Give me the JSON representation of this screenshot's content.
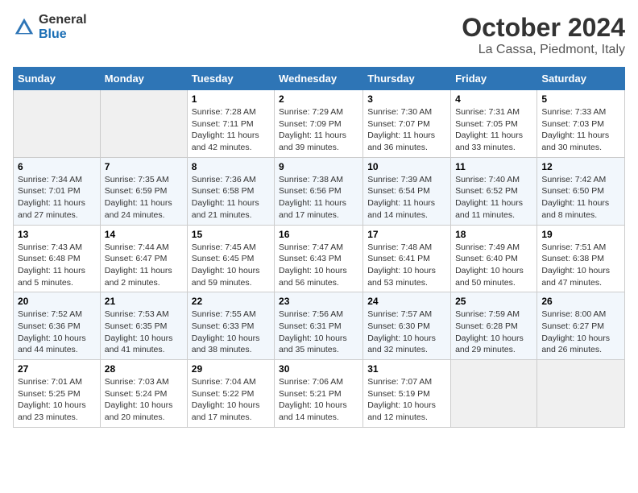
{
  "logo": {
    "general": "General",
    "blue": "Blue"
  },
  "title": "October 2024",
  "location": "La Cassa, Piedmont, Italy",
  "days_header": [
    "Sunday",
    "Monday",
    "Tuesday",
    "Wednesday",
    "Thursday",
    "Friday",
    "Saturday"
  ],
  "weeks": [
    [
      {
        "num": "",
        "info": ""
      },
      {
        "num": "",
        "info": ""
      },
      {
        "num": "1",
        "info": "Sunrise: 7:28 AM\nSunset: 7:11 PM\nDaylight: 11 hours and 42 minutes."
      },
      {
        "num": "2",
        "info": "Sunrise: 7:29 AM\nSunset: 7:09 PM\nDaylight: 11 hours and 39 minutes."
      },
      {
        "num": "3",
        "info": "Sunrise: 7:30 AM\nSunset: 7:07 PM\nDaylight: 11 hours and 36 minutes."
      },
      {
        "num": "4",
        "info": "Sunrise: 7:31 AM\nSunset: 7:05 PM\nDaylight: 11 hours and 33 minutes."
      },
      {
        "num": "5",
        "info": "Sunrise: 7:33 AM\nSunset: 7:03 PM\nDaylight: 11 hours and 30 minutes."
      }
    ],
    [
      {
        "num": "6",
        "info": "Sunrise: 7:34 AM\nSunset: 7:01 PM\nDaylight: 11 hours and 27 minutes."
      },
      {
        "num": "7",
        "info": "Sunrise: 7:35 AM\nSunset: 6:59 PM\nDaylight: 11 hours and 24 minutes."
      },
      {
        "num": "8",
        "info": "Sunrise: 7:36 AM\nSunset: 6:58 PM\nDaylight: 11 hours and 21 minutes."
      },
      {
        "num": "9",
        "info": "Sunrise: 7:38 AM\nSunset: 6:56 PM\nDaylight: 11 hours and 17 minutes."
      },
      {
        "num": "10",
        "info": "Sunrise: 7:39 AM\nSunset: 6:54 PM\nDaylight: 11 hours and 14 minutes."
      },
      {
        "num": "11",
        "info": "Sunrise: 7:40 AM\nSunset: 6:52 PM\nDaylight: 11 hours and 11 minutes."
      },
      {
        "num": "12",
        "info": "Sunrise: 7:42 AM\nSunset: 6:50 PM\nDaylight: 11 hours and 8 minutes."
      }
    ],
    [
      {
        "num": "13",
        "info": "Sunrise: 7:43 AM\nSunset: 6:48 PM\nDaylight: 11 hours and 5 minutes."
      },
      {
        "num": "14",
        "info": "Sunrise: 7:44 AM\nSunset: 6:47 PM\nDaylight: 11 hours and 2 minutes."
      },
      {
        "num": "15",
        "info": "Sunrise: 7:45 AM\nSunset: 6:45 PM\nDaylight: 10 hours and 59 minutes."
      },
      {
        "num": "16",
        "info": "Sunrise: 7:47 AM\nSunset: 6:43 PM\nDaylight: 10 hours and 56 minutes."
      },
      {
        "num": "17",
        "info": "Sunrise: 7:48 AM\nSunset: 6:41 PM\nDaylight: 10 hours and 53 minutes."
      },
      {
        "num": "18",
        "info": "Sunrise: 7:49 AM\nSunset: 6:40 PM\nDaylight: 10 hours and 50 minutes."
      },
      {
        "num": "19",
        "info": "Sunrise: 7:51 AM\nSunset: 6:38 PM\nDaylight: 10 hours and 47 minutes."
      }
    ],
    [
      {
        "num": "20",
        "info": "Sunrise: 7:52 AM\nSunset: 6:36 PM\nDaylight: 10 hours and 44 minutes."
      },
      {
        "num": "21",
        "info": "Sunrise: 7:53 AM\nSunset: 6:35 PM\nDaylight: 10 hours and 41 minutes."
      },
      {
        "num": "22",
        "info": "Sunrise: 7:55 AM\nSunset: 6:33 PM\nDaylight: 10 hours and 38 minutes."
      },
      {
        "num": "23",
        "info": "Sunrise: 7:56 AM\nSunset: 6:31 PM\nDaylight: 10 hours and 35 minutes."
      },
      {
        "num": "24",
        "info": "Sunrise: 7:57 AM\nSunset: 6:30 PM\nDaylight: 10 hours and 32 minutes."
      },
      {
        "num": "25",
        "info": "Sunrise: 7:59 AM\nSunset: 6:28 PM\nDaylight: 10 hours and 29 minutes."
      },
      {
        "num": "26",
        "info": "Sunrise: 8:00 AM\nSunset: 6:27 PM\nDaylight: 10 hours and 26 minutes."
      }
    ],
    [
      {
        "num": "27",
        "info": "Sunrise: 7:01 AM\nSunset: 5:25 PM\nDaylight: 10 hours and 23 minutes."
      },
      {
        "num": "28",
        "info": "Sunrise: 7:03 AM\nSunset: 5:24 PM\nDaylight: 10 hours and 20 minutes."
      },
      {
        "num": "29",
        "info": "Sunrise: 7:04 AM\nSunset: 5:22 PM\nDaylight: 10 hours and 17 minutes."
      },
      {
        "num": "30",
        "info": "Sunrise: 7:06 AM\nSunset: 5:21 PM\nDaylight: 10 hours and 14 minutes."
      },
      {
        "num": "31",
        "info": "Sunrise: 7:07 AM\nSunset: 5:19 PM\nDaylight: 10 hours and 12 minutes."
      },
      {
        "num": "",
        "info": ""
      },
      {
        "num": "",
        "info": ""
      }
    ]
  ]
}
